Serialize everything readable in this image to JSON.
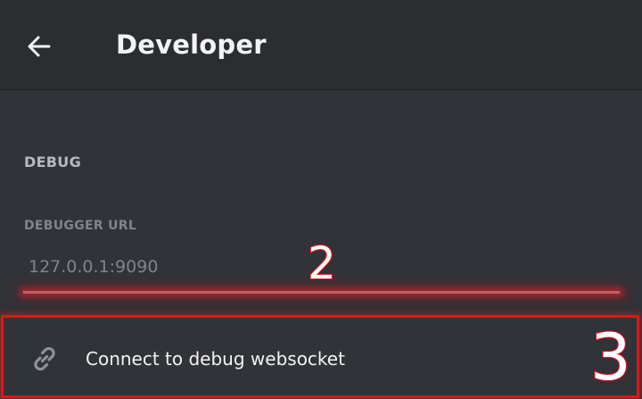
{
  "header": {
    "title": "Developer",
    "back_icon": "arrow-left-icon"
  },
  "debug_section": {
    "label": "DEBUG",
    "debugger_url": {
      "label": "DEBUGGER URL",
      "placeholder": "127.0.0.1:9090",
      "value": ""
    },
    "connect_action": {
      "label": "Connect to debug websocket",
      "icon": "link-icon"
    }
  },
  "annotations": {
    "marker_2": "2",
    "marker_3": "3"
  },
  "colors": {
    "background": "#313338",
    "header_background": "#2b2d31",
    "focus_underline": "#c0616a",
    "annotation_red": "#e3131b"
  }
}
